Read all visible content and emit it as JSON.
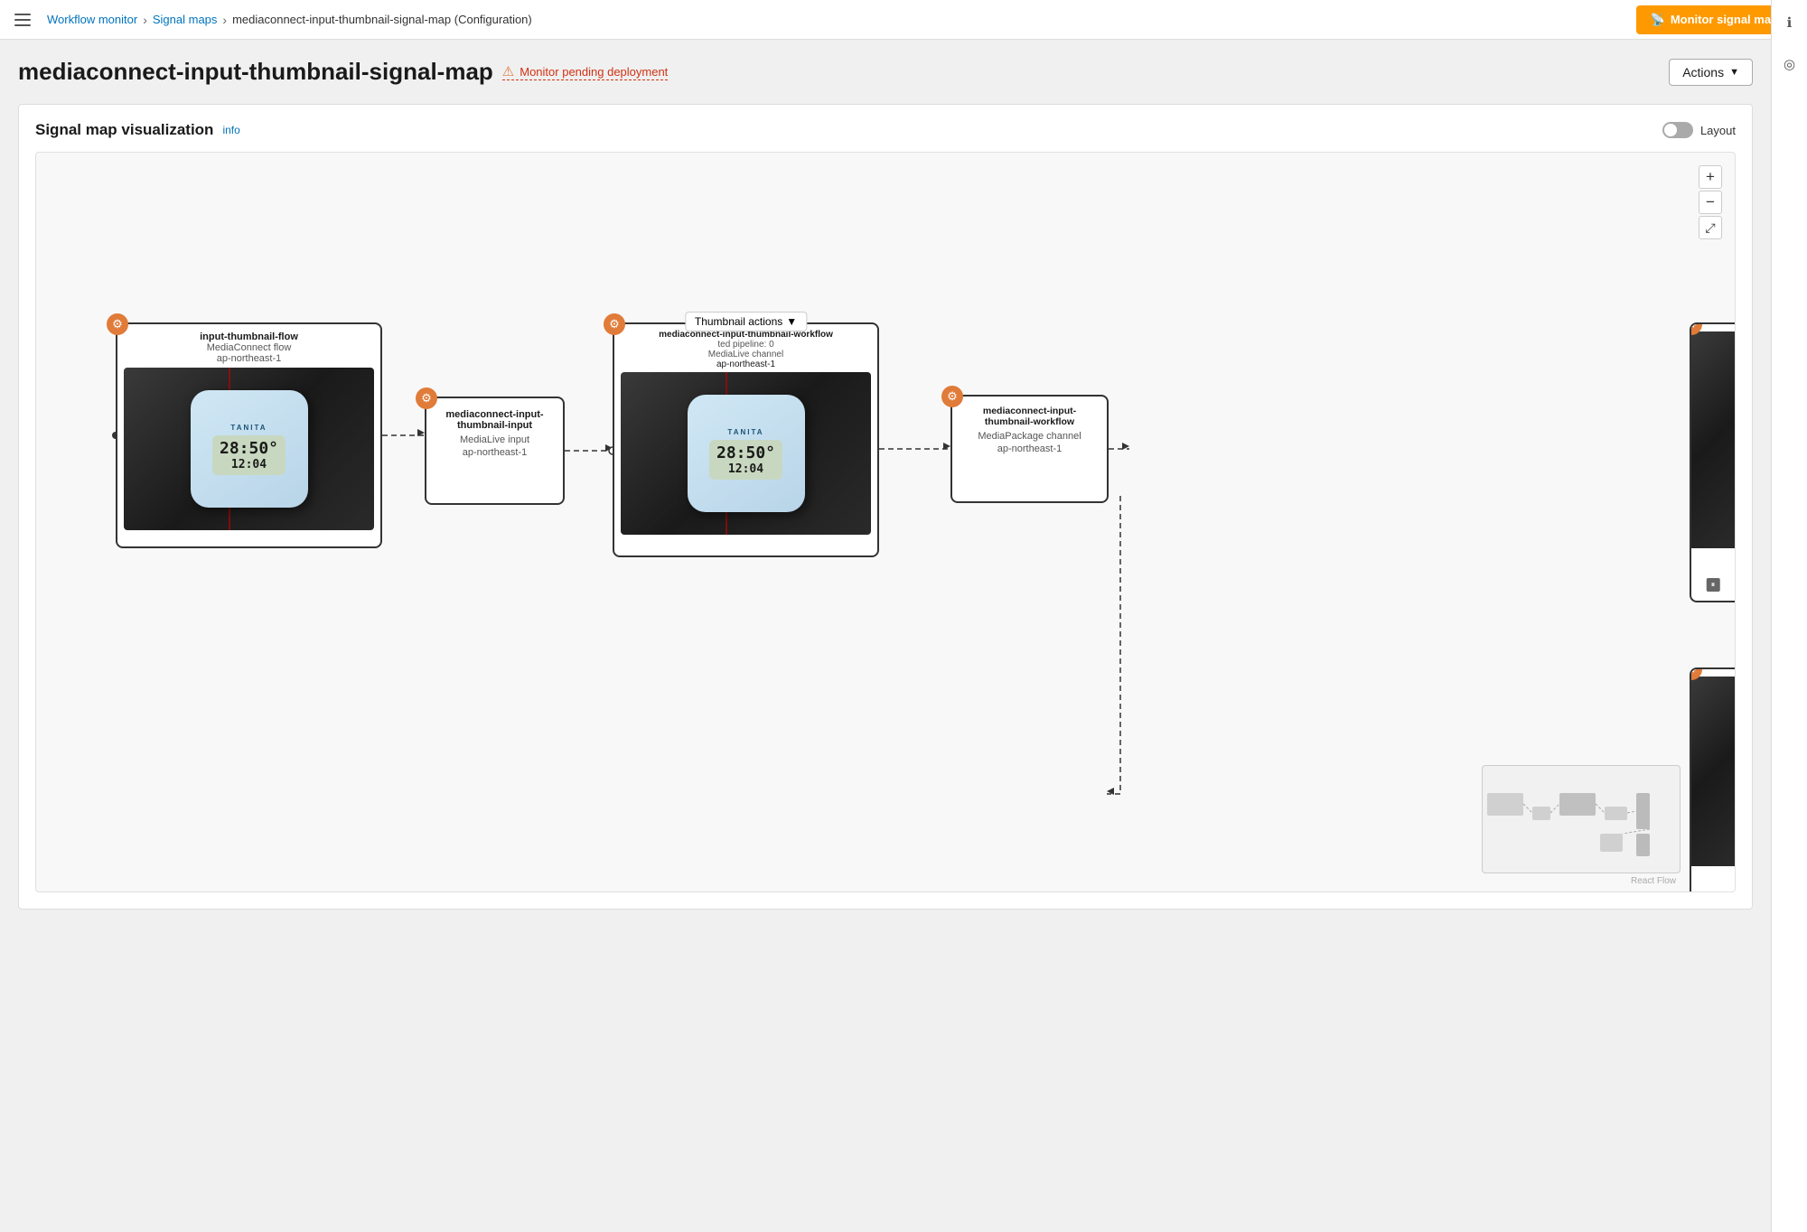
{
  "topbar": {
    "hamburger_label": "Menu",
    "breadcrumb": [
      {
        "label": "Workflow monitor",
        "href": "#"
      },
      {
        "label": "Signal maps",
        "href": "#"
      },
      {
        "label": "mediaconnect-input-thumbnail-signal-map (Configuration)",
        "href": null
      }
    ],
    "monitor_btn_label": "Monitor signal map",
    "monitor_btn_icon": "📡"
  },
  "page": {
    "title": "mediaconnect-input-thumbnail-signal-map",
    "pending_label": "Monitor pending deployment",
    "actions_label": "Actions"
  },
  "signal_map": {
    "title": "Signal map visualization",
    "info_label": "info",
    "layout_label": "Layout",
    "zoom_plus": "+",
    "zoom_minus": "−",
    "zoom_fit": "⤢"
  },
  "nodes": {
    "flow": {
      "name": "input-thumbnail-flow",
      "type": "MediaConnect flow",
      "region": "ap-northeast-1"
    },
    "input": {
      "name": "mediaconnect-input-thumbnail-input",
      "type": "MediaLive input",
      "region": "ap-northeast-1"
    },
    "channel": {
      "name": "mediaconnect-input-thumbnail-workflow",
      "status": "ted pipeline: 0",
      "type": "MediaLive channel",
      "region": "ap-northeast-1"
    },
    "thumbnail_actions_label": "Thumbnail actions",
    "package": {
      "name": "mediaconnect-input-thumbnail-workflow",
      "type": "MediaPackage channel",
      "region": "ap-northeast-1"
    }
  },
  "react_flow_label": "React Flow",
  "sidebar_right": {
    "info_icon": "ℹ",
    "location_icon": "◎"
  }
}
